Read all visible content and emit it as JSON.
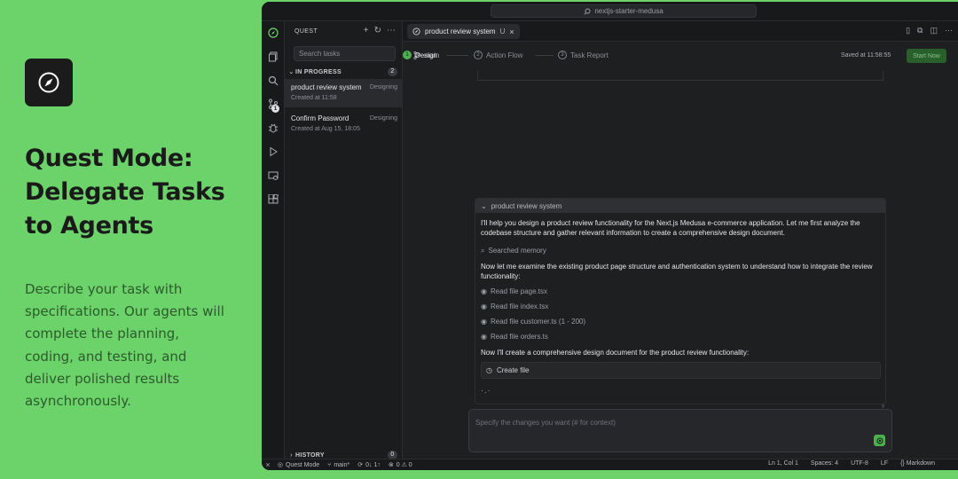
{
  "promo": {
    "title": "Quest Mode: Delegate Tasks to Agents",
    "description": "Describe your task with specifications. Our agents will complete the planning, coding, and testing, and deliver polished results asynchronously."
  },
  "window": {
    "command_center": "nextjs-starter-medusa"
  },
  "sidebar": {
    "header": "QUEST",
    "search_placeholder": "Search tasks",
    "in_progress": {
      "label": "IN PROGRESS",
      "count": "2"
    },
    "tasks": [
      {
        "title": "product review system",
        "status": "Designing",
        "created": "Created at 11:58"
      },
      {
        "title": "Confirm Password",
        "status": "Designing",
        "created": "Created at Aug 15, 18:05"
      }
    ],
    "history": {
      "label": "HISTORY",
      "count": "0"
    }
  },
  "activity_bar": {
    "scm_badge": "1"
  },
  "editor": {
    "tab": {
      "label": "product review system",
      "modifier": "U"
    },
    "branch": "main",
    "steps": [
      {
        "num": "1",
        "label": "Design"
      },
      {
        "num": "2",
        "label": "Action Flow"
      },
      {
        "num": "3",
        "label": "Task Report"
      }
    ],
    "saved": "Saved at 11:58:55",
    "start_button": "Start Now"
  },
  "chat": {
    "title": "product review system",
    "msg1": "I'll help you design a product review functionality for the Next.js Medusa e-commerce application. Let me first analyze the codebase structure and gather relevant information to create a comprehensive design document.",
    "searched": "Searched memory",
    "msg2": "Now let me examine the existing product page structure and authentication system to understand how to integrate the review functionality:",
    "reads": [
      "Read file page.tsx",
      "Read file index.tsx",
      "Read file customer.ts (1 - 200)",
      "Read file orders.ts"
    ],
    "msg3": "Now I'll create a comprehensive design document for the product review functionality:",
    "create_file": "Create file",
    "input_placeholder": "Specify the changes you want (# for context)"
  },
  "statusbar": {
    "mode": "Quest Mode",
    "branch": "main*",
    "sync": "0↓ 1↑",
    "problems": "0 ⚠ 0",
    "position": "Ln 1, Col 1",
    "spaces": "Spaces: 4",
    "encoding": "UTF-8",
    "eol": "LF",
    "language": "Markdown"
  },
  "colors": {
    "accent": "#4caf50",
    "background": "#6cd36a",
    "window": "#1e1f21"
  }
}
